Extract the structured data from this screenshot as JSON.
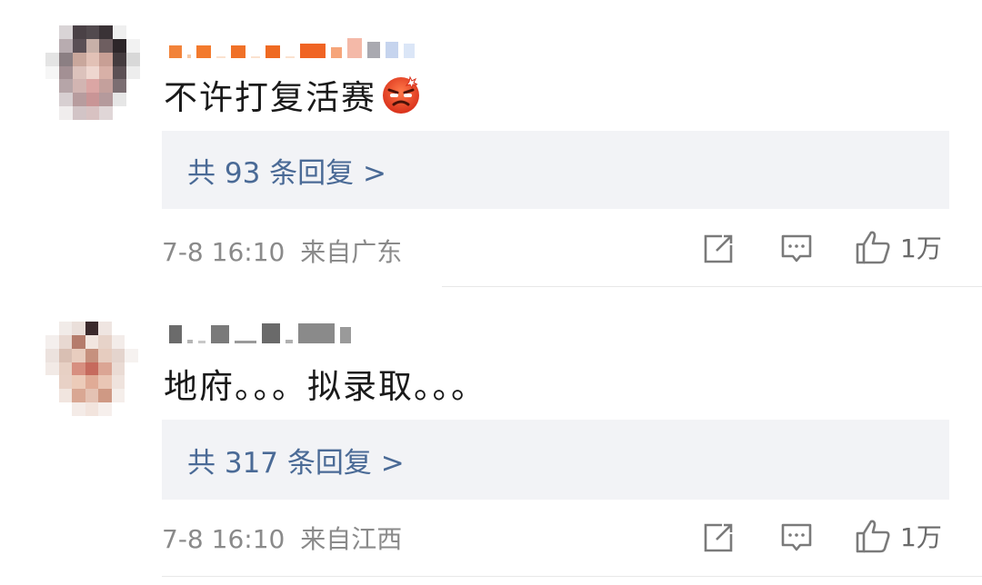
{
  "comments": [
    {
      "text": "不许打复活赛",
      "emoji": "angry-face-emoji",
      "reply_label": "共 93 条回复 >",
      "date": "7-8 16:10",
      "location": "来自广东",
      "likes": "1万",
      "icons": [
        "share-icon",
        "comment-icon",
        "like-icon"
      ]
    },
    {
      "text": "地府。。。拟录取。。。",
      "reply_label": "共 317 条回复 >",
      "date": "7-8 16:10",
      "location": "来自江西",
      "likes": "1万",
      "icons": [
        "share-icon",
        "comment-icon",
        "like-icon"
      ]
    }
  ],
  "colors": {
    "reply_box_bg": "#f2f3f6",
    "reply_link": "#4a6a96",
    "meta_text": "#8a8a8a",
    "emoji_red": "#e8442a"
  }
}
